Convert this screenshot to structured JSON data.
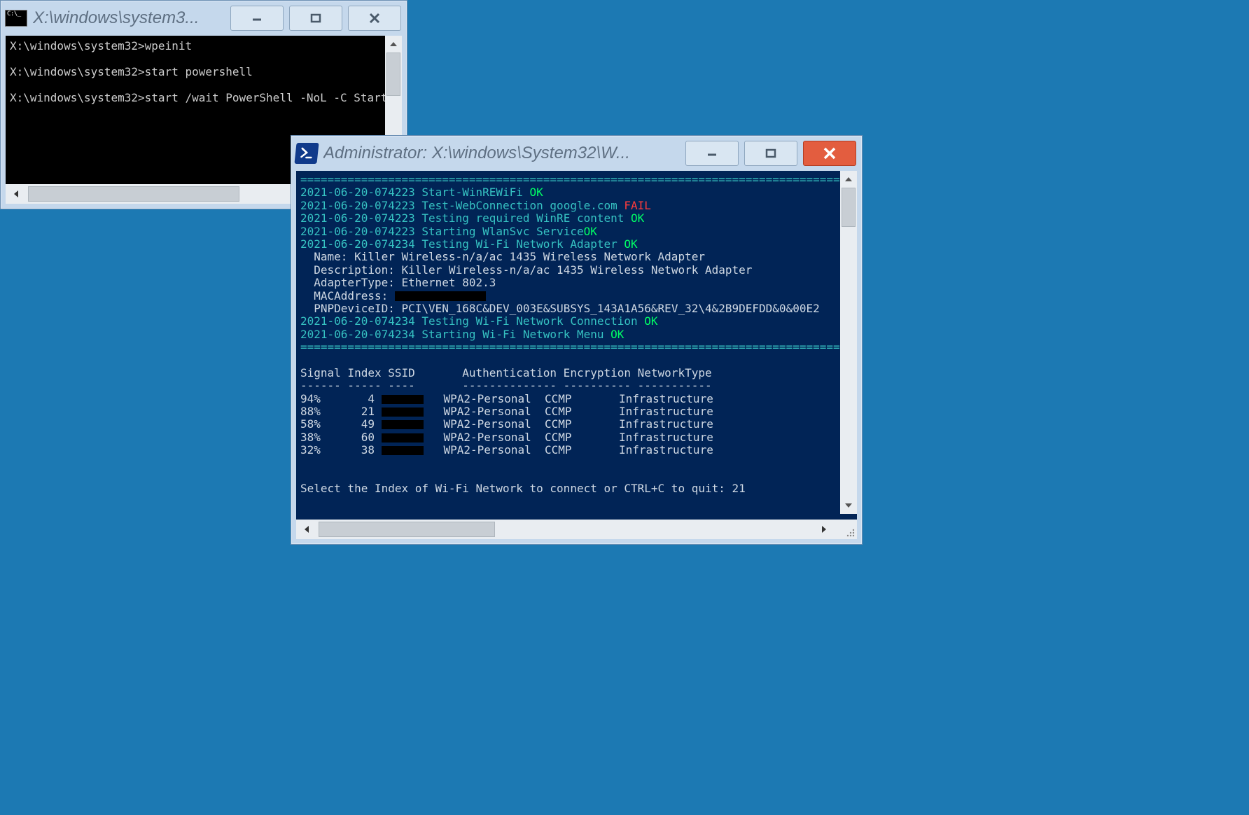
{
  "cmd_window": {
    "title": "X:\\windows\\system3...",
    "lines": [
      {
        "prompt": "X:\\windows\\system32>",
        "command": "wpeinit"
      },
      {
        "prompt": "X:\\windows\\system32>",
        "command": "start powershell"
      },
      {
        "prompt": "X:\\windows\\system32>",
        "command": "start /wait PowerShell -NoL -C Start-WinREWiFi"
      }
    ]
  },
  "ps_window": {
    "title": "Administrator: X:\\windows\\System32\\W...",
    "divider": "================================================================================",
    "log": [
      {
        "ts": "2021-06-20-074223",
        "msg": "Start-WinREWiFi",
        "status": "OK"
      },
      {
        "ts": "2021-06-20-074223",
        "msg": "Test-WebConnection google.com",
        "status": "FAIL"
      },
      {
        "ts": "2021-06-20-074223",
        "msg": "Testing required WinRE content",
        "status": "OK"
      },
      {
        "ts": "2021-06-20-074223",
        "msg": "Starting WlanSvc Service",
        "status": "OK",
        "nospace": true
      },
      {
        "ts": "2021-06-20-074234",
        "msg": "Testing Wi-Fi Network Adapter",
        "status": "OK"
      }
    ],
    "adapter": {
      "name_label": "Name:",
      "name": "Killer Wireless-n/a/ac 1435 Wireless Network Adapter",
      "desc_label": "Description:",
      "desc": "Killer Wireless-n/a/ac 1435 Wireless Network Adapter",
      "type_label": "AdapterType:",
      "type": "Ethernet 802.3",
      "mac_label": "MACAddress:",
      "pnp_label": "PNPDeviceID:",
      "pnp": "PCI\\VEN_168C&DEV_003E&SUBSYS_143A1A56&REV_32\\4&2B9DEFDD&0&00E2"
    },
    "log2": [
      {
        "ts": "2021-06-20-074234",
        "msg": "Testing Wi-Fi Network Connection",
        "status": "OK"
      },
      {
        "ts": "2021-06-20-074234",
        "msg": "Starting Wi-Fi Network Menu",
        "status": "OK"
      }
    ],
    "table": {
      "header": "Signal Index SSID       Authentication Encryption NetworkType",
      "divider": "------ ----- ----       -------------- ---------- -----------",
      "rows": [
        {
          "signal": "94%",
          "index": "4",
          "auth": "WPA2-Personal",
          "enc": "CCMP",
          "nettype": "Infrastructure"
        },
        {
          "signal": "88%",
          "index": "21",
          "auth": "WPA2-Personal",
          "enc": "CCMP",
          "nettype": "Infrastructure"
        },
        {
          "signal": "58%",
          "index": "49",
          "auth": "WPA2-Personal",
          "enc": "CCMP",
          "nettype": "Infrastructure"
        },
        {
          "signal": "38%",
          "index": "60",
          "auth": "WPA2-Personal",
          "enc": "CCMP",
          "nettype": "Infrastructure"
        },
        {
          "signal": "32%",
          "index": "38",
          "auth": "WPA2-Personal",
          "enc": "CCMP",
          "nettype": "Infrastructure"
        }
      ]
    },
    "prompt": "Select the Index of Wi-Fi Network to connect or CTRL+C to quit:",
    "prompt_value": "21"
  }
}
